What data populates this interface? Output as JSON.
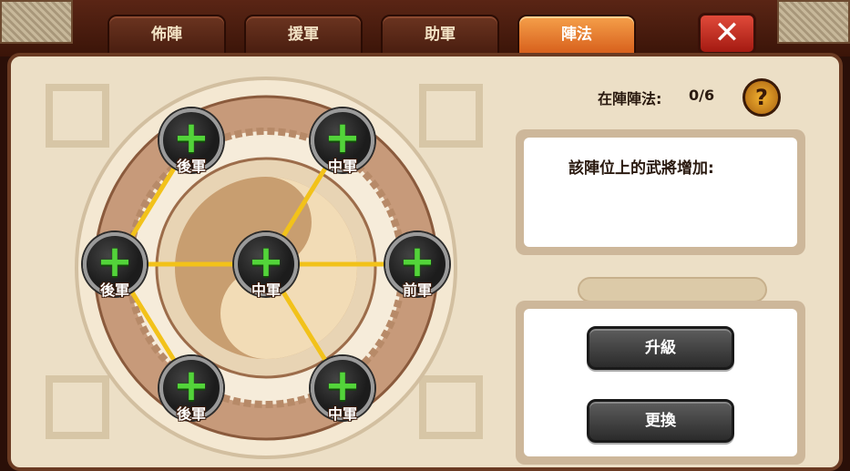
{
  "tabs": [
    {
      "label": "佈陣",
      "active": false
    },
    {
      "label": "援軍",
      "active": false
    },
    {
      "label": "助軍",
      "active": false
    },
    {
      "label": "陣法",
      "active": true
    }
  ],
  "close_label": "✕",
  "formation": {
    "count_label": "在陣陣法:",
    "count_value": "0/6",
    "help_label": "?",
    "slots": [
      {
        "label": "後軍"
      },
      {
        "label": "中軍"
      },
      {
        "label": "後軍"
      },
      {
        "label": "中軍"
      },
      {
        "label": "前軍"
      },
      {
        "label": "後軍"
      },
      {
        "label": "中軍"
      }
    ]
  },
  "info": {
    "title": "該陣位上的武將增加:"
  },
  "buttons": {
    "upgrade": "升級",
    "replace": "更換"
  },
  "colors": {
    "accent_tab": "#e07a2a",
    "plus_green": "#53d43a",
    "link_line": "#f2c21a"
  }
}
